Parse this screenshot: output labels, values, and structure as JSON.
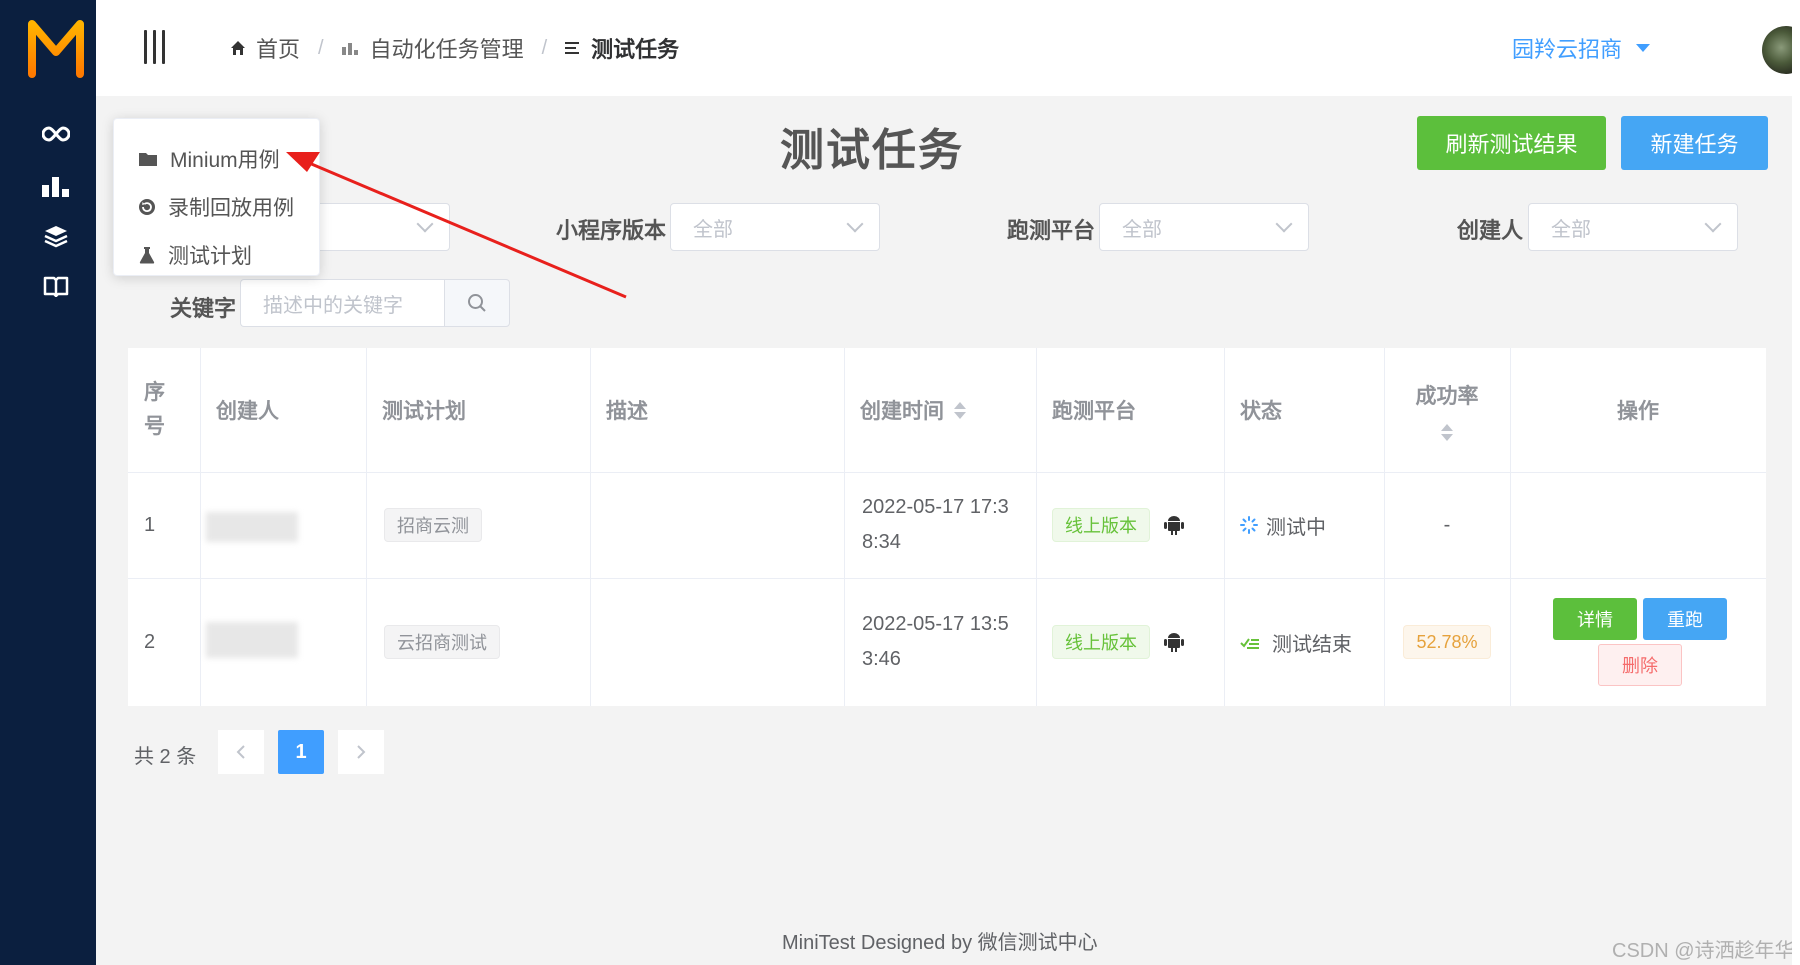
{
  "header": {
    "breadcrumb": [
      {
        "label": "首页",
        "icon": "home-icon"
      },
      {
        "label": "自动化任务管理",
        "icon": "bar-chart-icon"
      },
      {
        "label": "测试任务",
        "icon": "list-icon"
      }
    ],
    "breadcrumb_separator": "/",
    "org_name": "园羚云招商"
  },
  "page": {
    "title": "测试任务",
    "refresh_button": "刷新测试结果",
    "new_button": "新建任务"
  },
  "menu": {
    "items": [
      {
        "label": "Minium用例",
        "icon": "folder-icon"
      },
      {
        "label": "录制回放用例",
        "icon": "replay-icon"
      },
      {
        "label": "测试计划",
        "icon": "flask-icon"
      }
    ]
  },
  "filters": {
    "version_label": "小程序版本",
    "version_value": "全部",
    "platform_label": "跑测平台",
    "platform_value": "全部",
    "creator_label": "创建人",
    "creator_value": "全部",
    "keyword_label": "关键字",
    "keyword_placeholder": "描述中的关键字"
  },
  "table": {
    "columns": [
      "序号",
      "创建人",
      "测试计划",
      "描述",
      "创建时间",
      "跑测平台",
      "状态",
      "成功率",
      "操作"
    ],
    "rows": [
      {
        "index": "1",
        "plan": "招商云测",
        "time_line1": "2022-05-17 17:3",
        "time_line2": "8:34",
        "platform": "线上版本",
        "status": "测试中",
        "rate": "-"
      },
      {
        "index": "2",
        "plan": "云招商测试",
        "time_line1": "2022-05-17 13:5",
        "time_line2": "3:46",
        "platform": "线上版本",
        "status": "测试结束",
        "rate": "52.78%",
        "actions": {
          "detail": "详情",
          "rerun": "重跑",
          "delete": "删除"
        }
      }
    ]
  },
  "pagination": {
    "total": "共 2 条",
    "current": "1"
  },
  "footer": "MiniTest Designed by 微信测试中心",
  "watermark": "CSDN @诗洒趁年华",
  "colors": {
    "sidebar": "#0b1f3f",
    "primary": "#409eff",
    "success": "#5cbf3c",
    "danger": "#f56c6c",
    "annotation_arrow": "#e8201c"
  }
}
